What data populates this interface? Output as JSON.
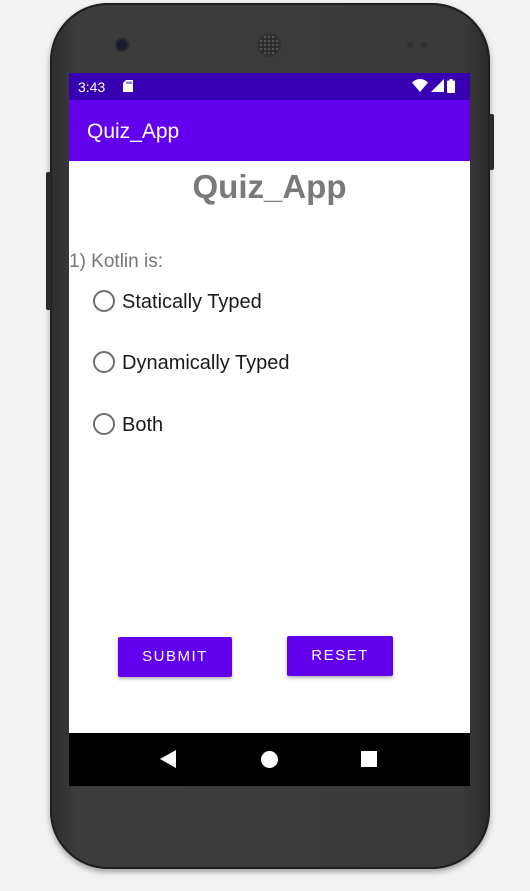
{
  "status_bar": {
    "time": "3:43",
    "icons": [
      "sd-card-icon",
      "wifi-icon",
      "signal-icon",
      "battery-icon"
    ]
  },
  "app_bar": {
    "title": "Quiz_App"
  },
  "content": {
    "title": "Quiz_App",
    "question": "1) Kotlin is:",
    "options": [
      "Statically Typed",
      "Dynamically Typed",
      "Both"
    ],
    "selected_option": null
  },
  "buttons": {
    "submit": "SUBMIT",
    "reset": "RESET"
  },
  "nav_bar": {
    "icons": [
      "back-icon",
      "home-icon",
      "recents-icon"
    ]
  },
  "colors": {
    "primary": "#6200ee",
    "primary_dark": "#3700b3",
    "title_text": "#7a7a7a"
  }
}
